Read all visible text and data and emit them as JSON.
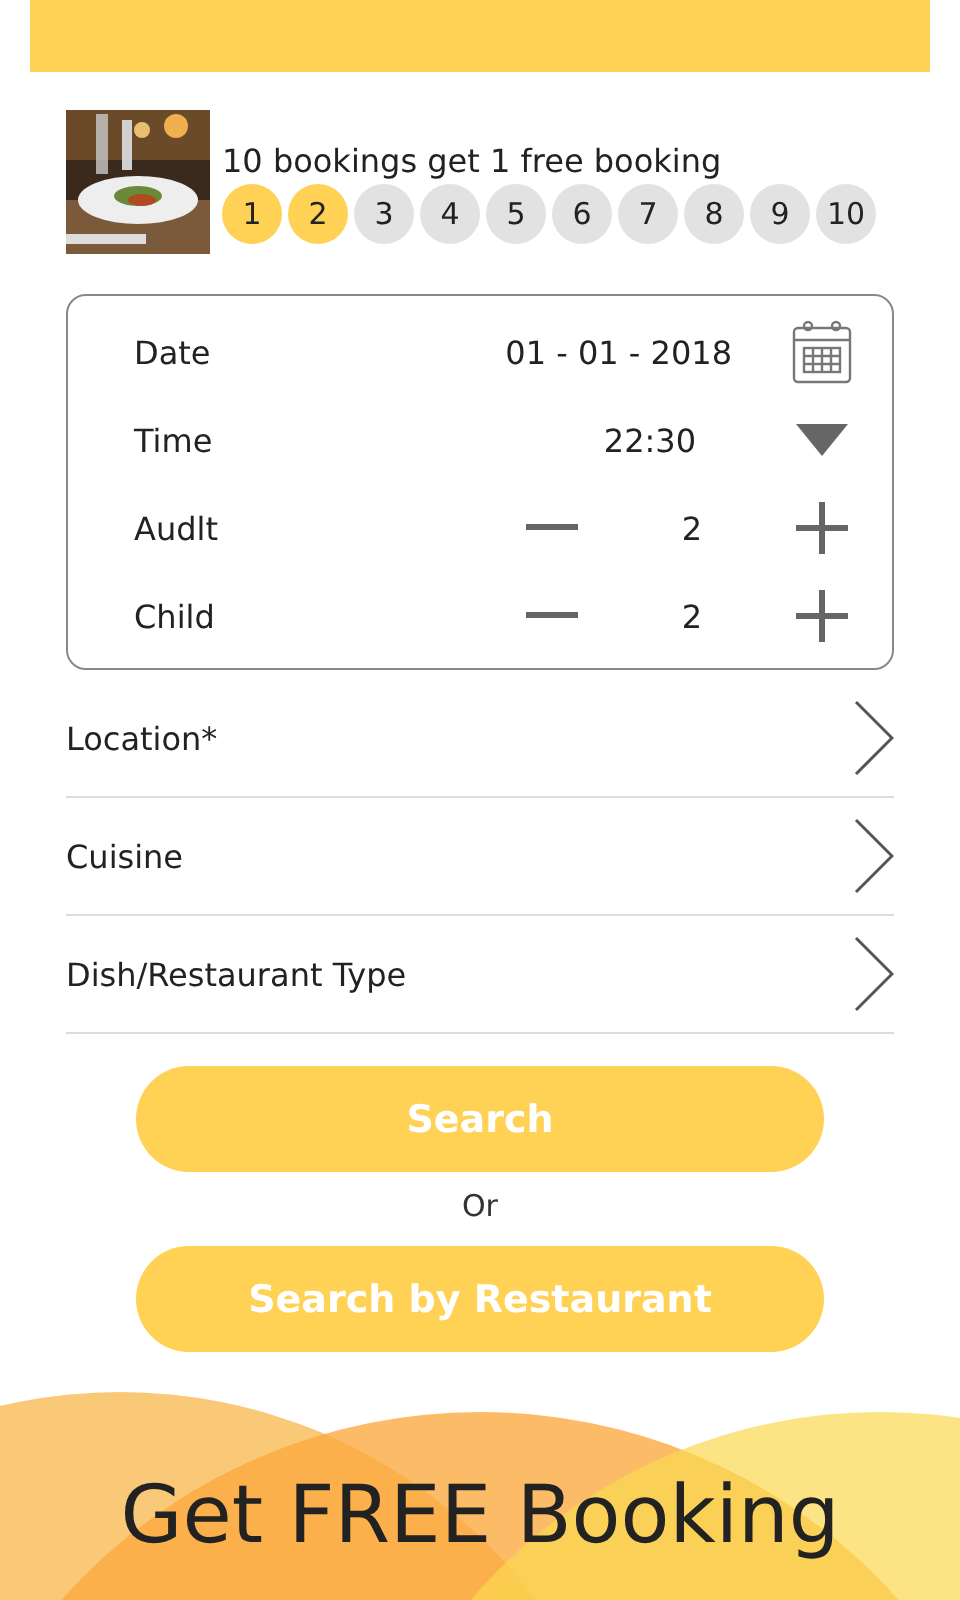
{
  "promo": {
    "kind": "picture",
    "headline": "10 bookings get 1 free booking",
    "stamps": [
      {
        "label": "1",
        "filled": true
      },
      {
        "label": "2",
        "filled": true
      },
      {
        "label": "3",
        "filled": false
      },
      {
        "label": "4",
        "filled": false
      },
      {
        "label": "5",
        "filled": false
      },
      {
        "label": "6",
        "filled": false
      },
      {
        "label": "7",
        "filled": false
      },
      {
        "label": "8",
        "filled": false
      },
      {
        "label": "9",
        "filled": false
      },
      {
        "label": "10",
        "filled": false
      }
    ]
  },
  "form": [
    {
      "kind": "date",
      "label": "Date",
      "value": "01 - 01 - 2018"
    },
    {
      "kind": "time",
      "label": "Time",
      "value": "22:30"
    },
    {
      "kind": "counter",
      "label": "Audlt",
      "value": "2"
    },
    {
      "kind": "counter",
      "label": "Child",
      "value": "2"
    }
  ],
  "filters": [
    "Location*",
    "Cuisine",
    "Dish/Restaurant Type"
  ],
  "search_button": "Search",
  "separator": "Or",
  "restaurant_button": "Search by Restaurant",
  "banner": "Get FREE Booking"
}
